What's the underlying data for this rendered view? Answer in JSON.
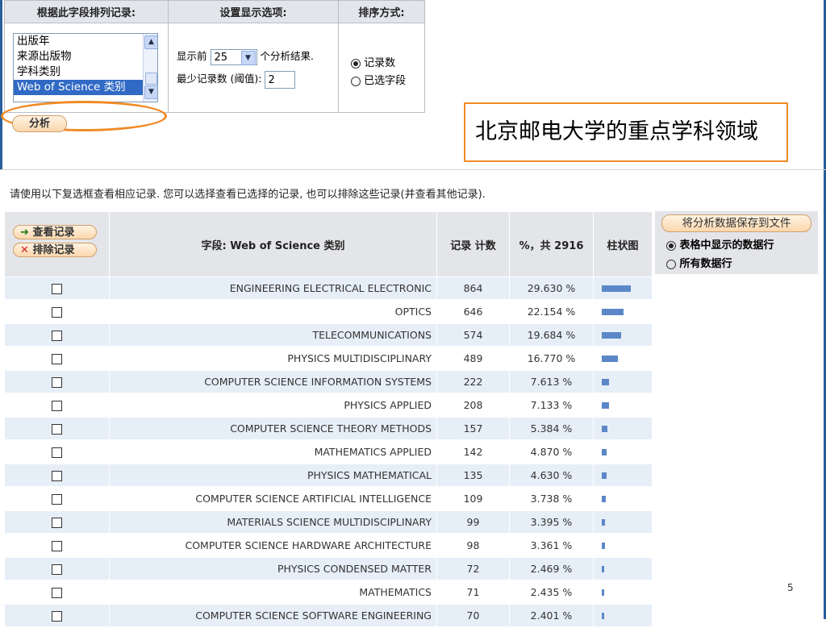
{
  "controls": {
    "col1_header": "根据此字段排列记录:",
    "col2_header": "设置显示选项:",
    "col3_header": "排序方式:",
    "field_options": [
      "出版年",
      "来源出版物",
      "学科类别",
      "Web of Science 类别"
    ],
    "show_prefix": "显示前",
    "show_count": "25",
    "show_suffix": "个分析结果.",
    "min_records_label": "最少记录数 (阈值):",
    "min_records_value": "2",
    "sort_by_records": "记录数",
    "sort_by_field": "已选字段",
    "analyze_button": "分析"
  },
  "callout": "北京邮电大学的重点学科领域",
  "instruction": "请使用以下复选框查看相应记录. 您可以选择查看已选择的记录, 也可以排除这些记录(并查看其他记录).",
  "results": {
    "view_button": "查看记录",
    "exclude_button": "排除记录",
    "field_header": "字段: Web of Science 类别",
    "count_header": "记录 计数",
    "pct_header": "%，共 2916",
    "bar_header": "柱状图",
    "rows": [
      {
        "field": "ENGINEERING ELECTRICAL ELECTRONIC",
        "count": "864",
        "pct": "29.630 %",
        "share": 29.63
      },
      {
        "field": "OPTICS",
        "count": "646",
        "pct": "22.154 %",
        "share": 22.154
      },
      {
        "field": "TELECOMMUNICATIONS",
        "count": "574",
        "pct": "19.684 %",
        "share": 19.684
      },
      {
        "field": "PHYSICS MULTIDISCIPLINARY",
        "count": "489",
        "pct": "16.770 %",
        "share": 16.77
      },
      {
        "field": "COMPUTER SCIENCE INFORMATION SYSTEMS",
        "count": "222",
        "pct": "7.613 %",
        "share": 7.613
      },
      {
        "field": "PHYSICS APPLIED",
        "count": "208",
        "pct": "7.133 %",
        "share": 7.133
      },
      {
        "field": "COMPUTER SCIENCE THEORY METHODS",
        "count": "157",
        "pct": "5.384 %",
        "share": 5.384
      },
      {
        "field": "MATHEMATICS APPLIED",
        "count": "142",
        "pct": "4.870 %",
        "share": 4.87
      },
      {
        "field": "PHYSICS MATHEMATICAL",
        "count": "135",
        "pct": "4.630 %",
        "share": 4.63
      },
      {
        "field": "COMPUTER SCIENCE ARTIFICIAL INTELLIGENCE",
        "count": "109",
        "pct": "3.738 %",
        "share": 3.738
      },
      {
        "field": "MATERIALS SCIENCE MULTIDISCIPLINARY",
        "count": "99",
        "pct": "3.395 %",
        "share": 3.395
      },
      {
        "field": "COMPUTER SCIENCE HARDWARE ARCHITECTURE",
        "count": "98",
        "pct": "3.361 %",
        "share": 3.361
      },
      {
        "field": "PHYSICS CONDENSED MATTER",
        "count": "72",
        "pct": "2.469 %",
        "share": 2.469
      },
      {
        "field": "MATHEMATICS",
        "count": "71",
        "pct": "2.435 %",
        "share": 2.435
      },
      {
        "field": "COMPUTER SCIENCE SOFTWARE ENGINEERING",
        "count": "70",
        "pct": "2.401 %",
        "share": 2.401
      }
    ]
  },
  "save": {
    "button": "将分析数据保存到文件",
    "option_table_rows": "表格中显示的数据行",
    "option_all_rows": "所有数据行"
  },
  "page_number": "5",
  "colors": {
    "accent_orange": "#f08a24",
    "bar_blue": "#5b87c8",
    "row_tint": "#e6eef7"
  }
}
